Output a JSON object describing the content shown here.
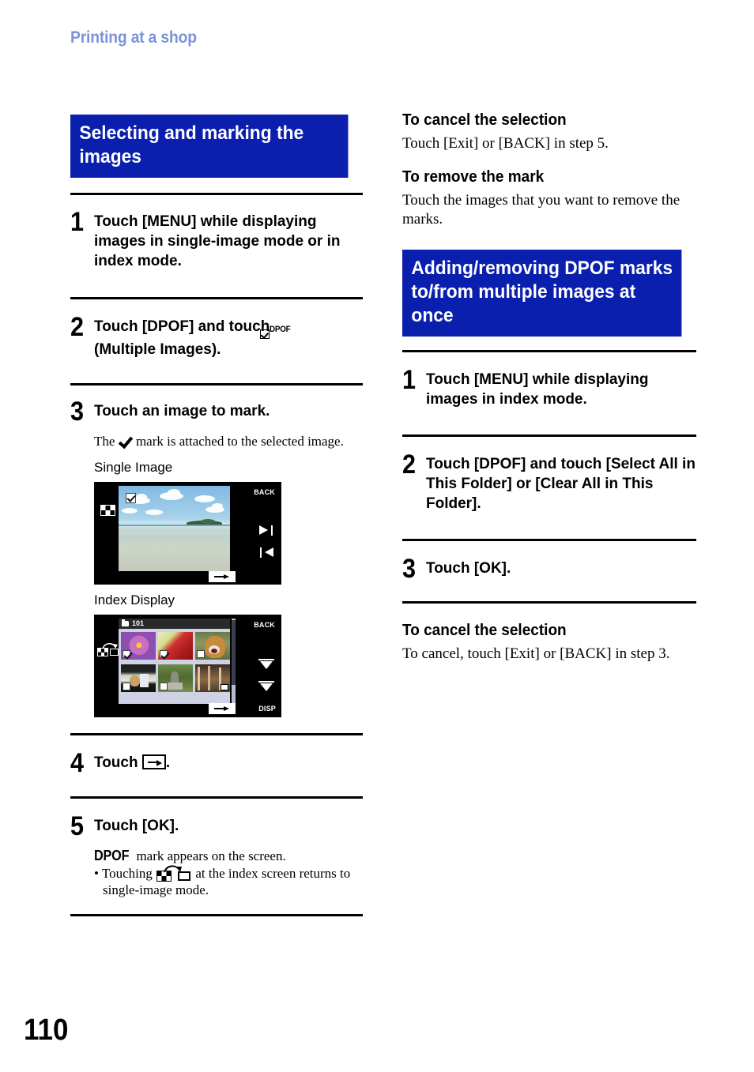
{
  "running_head": "Printing at a shop",
  "page_number": "110",
  "colors": {
    "banner_blue": "#0b1fae",
    "running_head_blue": "#7a93d8",
    "text_black": "#000000"
  },
  "left_column": {
    "banner": {
      "line1": "Selecting and marking the",
      "line2": "images"
    },
    "steps": [
      {
        "number": "1",
        "text": "Touch [MENU] while displaying images in single-image mode or in index mode."
      },
      {
        "number": "2",
        "text_before_icon": "Touch [DPOF] and touch ",
        "icon": "dpof-multiple-images-icon",
        "text_after_icon": "(Multiple Images)."
      },
      {
        "number": "3",
        "text": "Touch an image to mark.",
        "note_before_icon": "The ",
        "note_icon": "checkmark-icon",
        "note_after_icon": " mark is attached to the selected image.",
        "caption_single": "Single Image",
        "caption_index": "Index Display"
      },
      {
        "number": "4",
        "text_before_icon": "Touch ",
        "icon": "arrow-box-icon",
        "text_after_icon": "."
      },
      {
        "number": "5",
        "text": "Touch [OK].",
        "note_icon": "dpof-word-icon",
        "note_text": " mark appears on the screen.",
        "bullet_before_icon": "• Touching ",
        "bullet_icon": "index-to-single-image-icon",
        "bullet_after_icon": " at the index screen returns to single-image mode."
      }
    ],
    "single_image_screen": {
      "label_back": "BACK",
      "checkbox_checked": true,
      "icons": [
        "index-view-icon",
        "next-image-icon",
        "previous-image-icon",
        "enter-arrow-icon"
      ]
    },
    "index_display_screen": {
      "folder_number": "101",
      "label_back": "BACK",
      "label_disp": "DISP",
      "thumbnails": [
        {
          "name": "purple-lotus-flower",
          "checked": true
        },
        {
          "name": "red-flower",
          "checked": true
        },
        {
          "name": "dog",
          "checked": false
        },
        {
          "name": "cat-indoors",
          "checked": false
        },
        {
          "name": "cat-on-stone",
          "checked": false
        },
        {
          "name": "trees-night-movie",
          "checked": false,
          "movie": true
        }
      ],
      "icons": [
        "index-to-single-image-icon",
        "scroll-up-icon",
        "scroll-down-icon",
        "enter-arrow-icon"
      ]
    }
  },
  "right_column": {
    "sections": [
      {
        "heading": "To cancel the selection",
        "body": "Touch [Exit] or [BACK] in step 5."
      },
      {
        "heading": "To remove the mark",
        "body": "Touch the images that you want to remove the marks."
      }
    ],
    "banner": {
      "line1": "Adding/removing DPOF marks",
      "line2": "to/from multiple images at once"
    },
    "steps": [
      {
        "number": "1",
        "text": "Touch [MENU] while displaying images in index mode."
      },
      {
        "number": "2",
        "text": "Touch [DPOF] and touch [Select All in This Folder] or [Clear All in This Folder]."
      },
      {
        "number": "3",
        "text": "Touch [OK]."
      }
    ],
    "footer_section": {
      "heading": "To cancel the selection",
      "body": "To cancel, touch [Exit] or [BACK] in step 3."
    }
  }
}
